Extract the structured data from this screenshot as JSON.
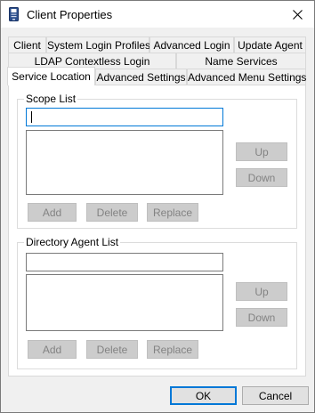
{
  "window": {
    "title": "Client Properties",
    "icon": "app-icon",
    "close_icon": "close-icon"
  },
  "tabs": {
    "row1": [
      "Client",
      "System Login Profiles",
      "Advanced Login",
      "Update Agent"
    ],
    "row2": [
      "LDAP Contextless Login",
      "Name Services"
    ],
    "row3": [
      "Service Location",
      "Advanced Settings",
      "Advanced Menu Settings"
    ],
    "active": "Service Location"
  },
  "scope": {
    "label": "Scope List",
    "input_value": "",
    "up_label": "Up",
    "down_label": "Down",
    "add_label": "Add",
    "delete_label": "Delete",
    "replace_label": "Replace"
  },
  "directory": {
    "label": "Directory Agent List",
    "input_value": "",
    "up_label": "Up",
    "down_label": "Down",
    "add_label": "Add",
    "delete_label": "Delete",
    "replace_label": "Replace"
  },
  "footer": {
    "ok_label": "OK",
    "cancel_label": "Cancel"
  },
  "colors": {
    "focus_accent": "#0078d7",
    "dialog_bg": "#f0f0f0",
    "disabled_button": "#cccccc",
    "disabled_text": "#838383"
  }
}
